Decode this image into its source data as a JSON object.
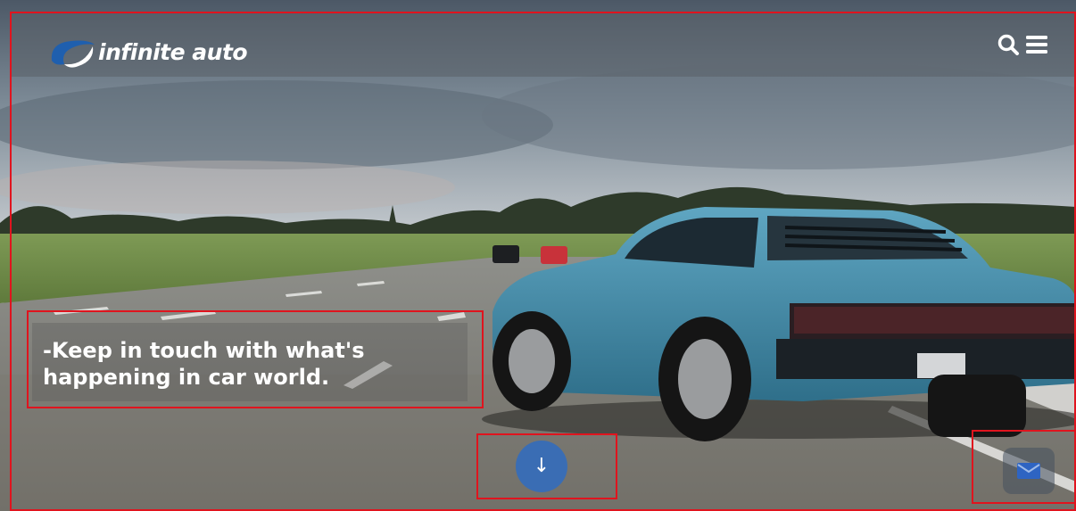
{
  "site": {
    "brand_name": "infinite auto",
    "logo_icon": "swirl-logo-icon"
  },
  "header": {
    "search_icon": "search-icon",
    "menu_icon": "hamburger-menu-icon"
  },
  "hero": {
    "tagline": "-Keep in touch with what's happening in car world.",
    "scroll_symbol": "↓",
    "contact_icon": "envelope-icon"
  },
  "colors": {
    "accent": "#3a6db4",
    "annotation": "#e0141e",
    "car": "#3f8aa8"
  }
}
